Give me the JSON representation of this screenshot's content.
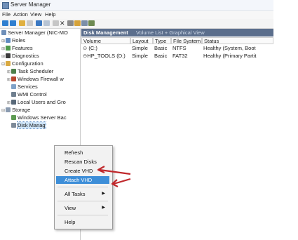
{
  "window": {
    "title": "Server Manager"
  },
  "menu": [
    "File",
    "Action",
    "View",
    "Help"
  ],
  "tree": {
    "root": "Server Manager (NIC-MO",
    "roles": "Roles",
    "features": "Features",
    "diagnostics": "Diagnostics",
    "configuration": "Configuration",
    "task_scheduler": "Task Scheduler",
    "firewall": "Windows Firewall w",
    "services": "Services",
    "wmi": "WMI Control",
    "local_users": "Local Users and Gro",
    "storage": "Storage",
    "wsb": "Windows Server Bac",
    "disk_mgmt": "Disk Manag"
  },
  "disk_management": {
    "title": "Disk Management",
    "subtitle": "Volume List + Graphical View",
    "columns": [
      "Volume",
      "Layout",
      "Type",
      "File System",
      "Status"
    ],
    "rows": [
      [
        "(C:)",
        "Simple",
        "Basic",
        "NTFS",
        "Healthy (System, Boot"
      ],
      [
        "HP_TOOLS (D:)",
        "Simple",
        "Basic",
        "FAT32",
        "Healthy (Primary Partit"
      ]
    ]
  },
  "context_menu": {
    "refresh": "Refresh",
    "rescan": "Rescan Disks",
    "create_vhd": "Create VHD",
    "attach_vhd": "Attach VHD",
    "all_tasks": "All Tasks",
    "view": "View",
    "help": "Help"
  },
  "colors": {
    "highlight": "#3d8ed8",
    "arrow": "#c0282c",
    "header": "#5b6e8c"
  }
}
